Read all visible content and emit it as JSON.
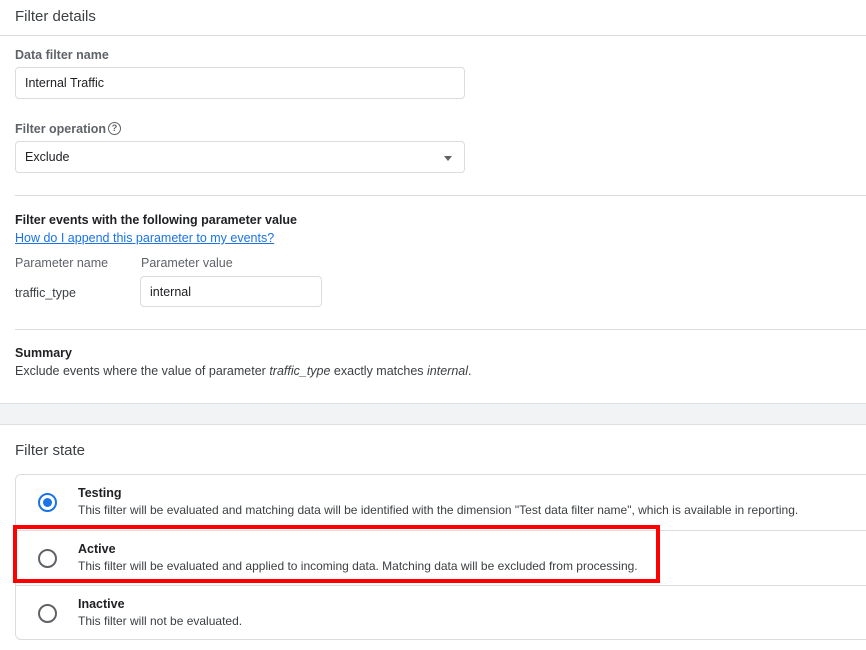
{
  "details": {
    "title": "Filter details",
    "name_label": "Data filter name",
    "name_value": "Internal Traffic",
    "operation_label": "Filter operation",
    "operation_value": "Exclude"
  },
  "events": {
    "heading": "Filter events with the following parameter value",
    "help_link": "How do I append this parameter to my events?",
    "param_name_header": "Parameter name",
    "param_value_header": "Parameter value",
    "param_name": "traffic_type",
    "param_value": "internal"
  },
  "summary": {
    "heading": "Summary",
    "prefix": "Exclude events where the value of parameter ",
    "param": "traffic_type",
    "middle": " exactly matches ",
    "value": "internal",
    "suffix": "."
  },
  "state": {
    "title": "Filter state",
    "options": [
      {
        "label": "Testing",
        "description": "This filter will be evaluated and matching data will be identified with the dimension \"Test data filter name\", which is available in reporting.",
        "selected": true
      },
      {
        "label": "Active",
        "description": "This filter will be evaluated and applied to incoming data. Matching data will be excluded from processing.",
        "selected": false
      },
      {
        "label": "Inactive",
        "description": "This filter will not be evaluated.",
        "selected": false
      }
    ]
  },
  "icons": {
    "help": "help-circle-icon",
    "dropdown": "caret-down-icon"
  },
  "colors": {
    "accent": "#1a73e8",
    "highlight": "#ff0000"
  }
}
